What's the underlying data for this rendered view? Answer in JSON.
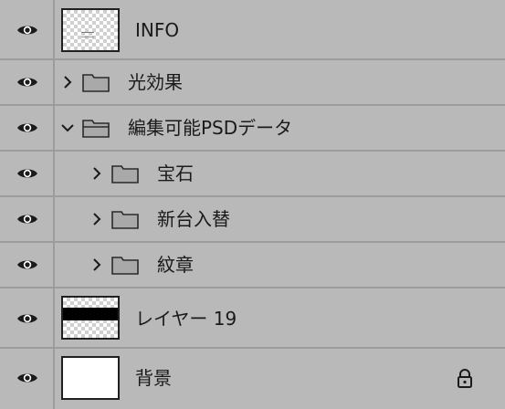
{
  "layers": [
    {
      "label": "INFO",
      "kind": "thumb-info",
      "visible": true
    },
    {
      "label": "光効果",
      "kind": "group",
      "expanded": false,
      "indent": 0,
      "visible": true
    },
    {
      "label": "編集可能PSDデータ",
      "kind": "group",
      "expanded": true,
      "indent": 0,
      "visible": true
    },
    {
      "label": "宝石",
      "kind": "group",
      "expanded": false,
      "indent": 1,
      "visible": true
    },
    {
      "label": "新台入替",
      "kind": "group",
      "expanded": false,
      "indent": 1,
      "visible": true
    },
    {
      "label": "紋章",
      "kind": "group",
      "expanded": false,
      "indent": 1,
      "visible": true
    },
    {
      "label": "レイヤー 19",
      "kind": "thumb-band",
      "visible": true
    },
    {
      "label": "背景",
      "kind": "thumb-white",
      "visible": true,
      "locked": true
    }
  ],
  "colors": {
    "panel_bg": "#b9b9b9",
    "separator": "#9c9c9c",
    "text": "#1a1a1a"
  },
  "icons": [
    "eye-icon",
    "chevron-right-icon",
    "chevron-down-icon",
    "folder-icon",
    "lock-icon"
  ]
}
